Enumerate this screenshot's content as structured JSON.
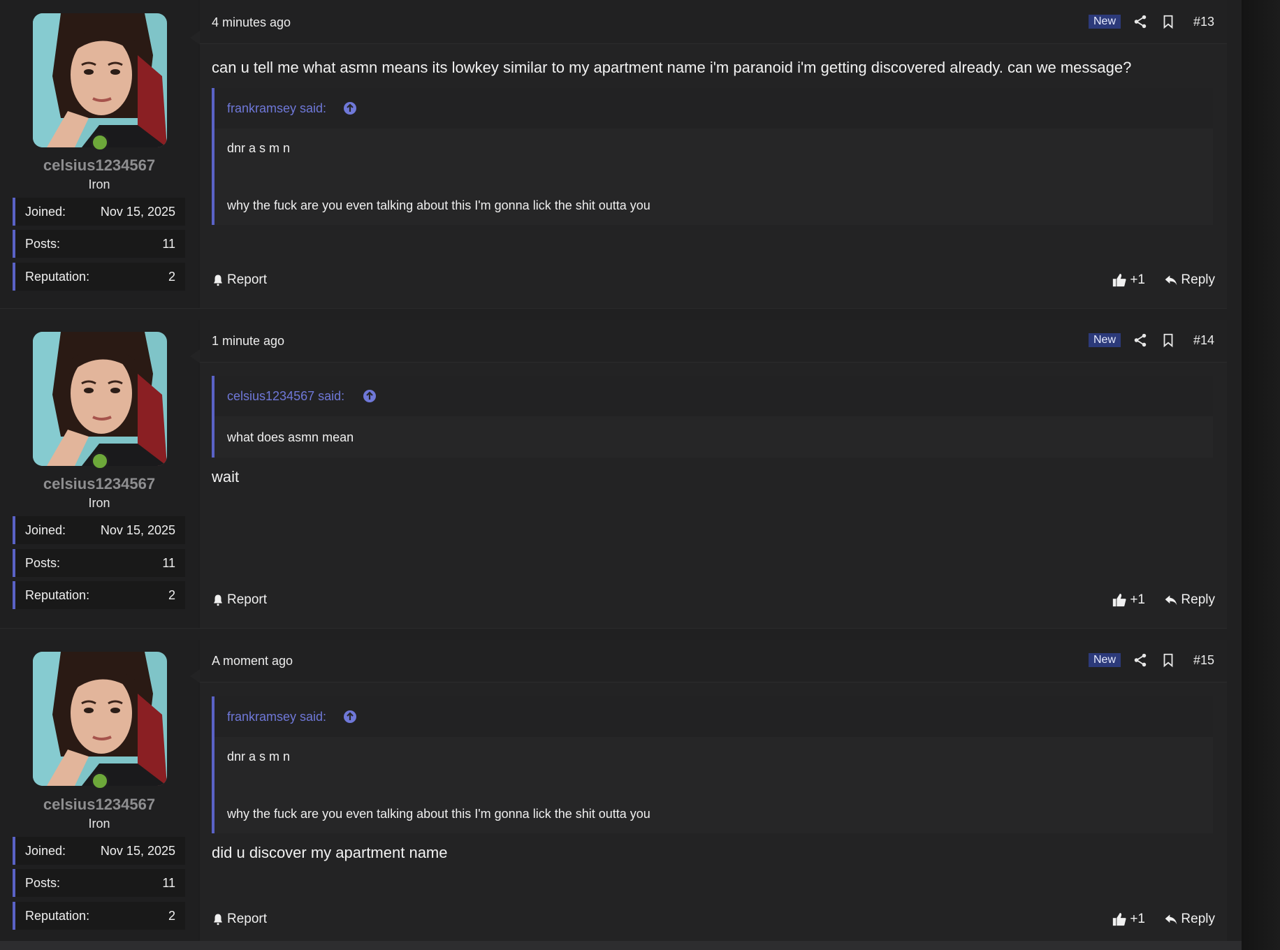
{
  "colors": {
    "accent": "#5a62c6",
    "quote_author": "#6f78d8",
    "online": "#6da83a",
    "new_badge_bg": "#2c3a7a"
  },
  "posts": [
    {
      "time": "4 minutes ago",
      "new_badge": "New",
      "number": "#13",
      "user": {
        "name": "celsius1234567",
        "rank": "Iron",
        "stats": [
          {
            "label": "Joined:",
            "value": "Nov 15, 2025"
          },
          {
            "label": "Posts:",
            "value": "11"
          },
          {
            "label": "Reputation:",
            "value": "2"
          }
        ]
      },
      "body_before": "can u tell me what asmn means its lowkey similar to my apartment name i'm paranoid i'm getting discovered already. can we message?",
      "quote": {
        "author": "frankramsey said:",
        "lines": [
          "dnr a s m n",
          "why the fuck are you even talking about this I'm gonna lick the shit outta you"
        ]
      },
      "body_after": "",
      "report": "Report",
      "like": "+1",
      "reply": "Reply"
    },
    {
      "time": "1 minute ago",
      "new_badge": "New",
      "number": "#14",
      "user": {
        "name": "celsius1234567",
        "rank": "Iron",
        "stats": [
          {
            "label": "Joined:",
            "value": "Nov 15, 2025"
          },
          {
            "label": "Posts:",
            "value": "11"
          },
          {
            "label": "Reputation:",
            "value": "2"
          }
        ]
      },
      "body_before": "",
      "quote": {
        "author": "celsius1234567 said:",
        "lines": [
          "what does asmn mean"
        ]
      },
      "body_after": "wait",
      "report": "Report",
      "like": "+1",
      "reply": "Reply"
    },
    {
      "time": "A moment ago",
      "new_badge": "New",
      "number": "#15",
      "user": {
        "name": "celsius1234567",
        "rank": "Iron",
        "stats": [
          {
            "label": "Joined:",
            "value": "Nov 15, 2025"
          },
          {
            "label": "Posts:",
            "value": "11"
          },
          {
            "label": "Reputation:",
            "value": "2"
          }
        ]
      },
      "body_before": "",
      "quote": {
        "author": "frankramsey said:",
        "lines": [
          "dnr a s m n",
          "why the fuck are you even talking about this I'm gonna lick the shit outta you"
        ]
      },
      "body_after": "did u discover my apartment name",
      "report": "Report",
      "like": "+1",
      "reply": "Reply"
    }
  ],
  "icons": {
    "share": "share-icon",
    "bookmark": "bookmark-icon",
    "up_arrow": "arrow-up-circle-icon",
    "bell": "bell-icon",
    "thumbs_up": "thumbs-up-icon",
    "reply": "reply-arrow-icon"
  }
}
